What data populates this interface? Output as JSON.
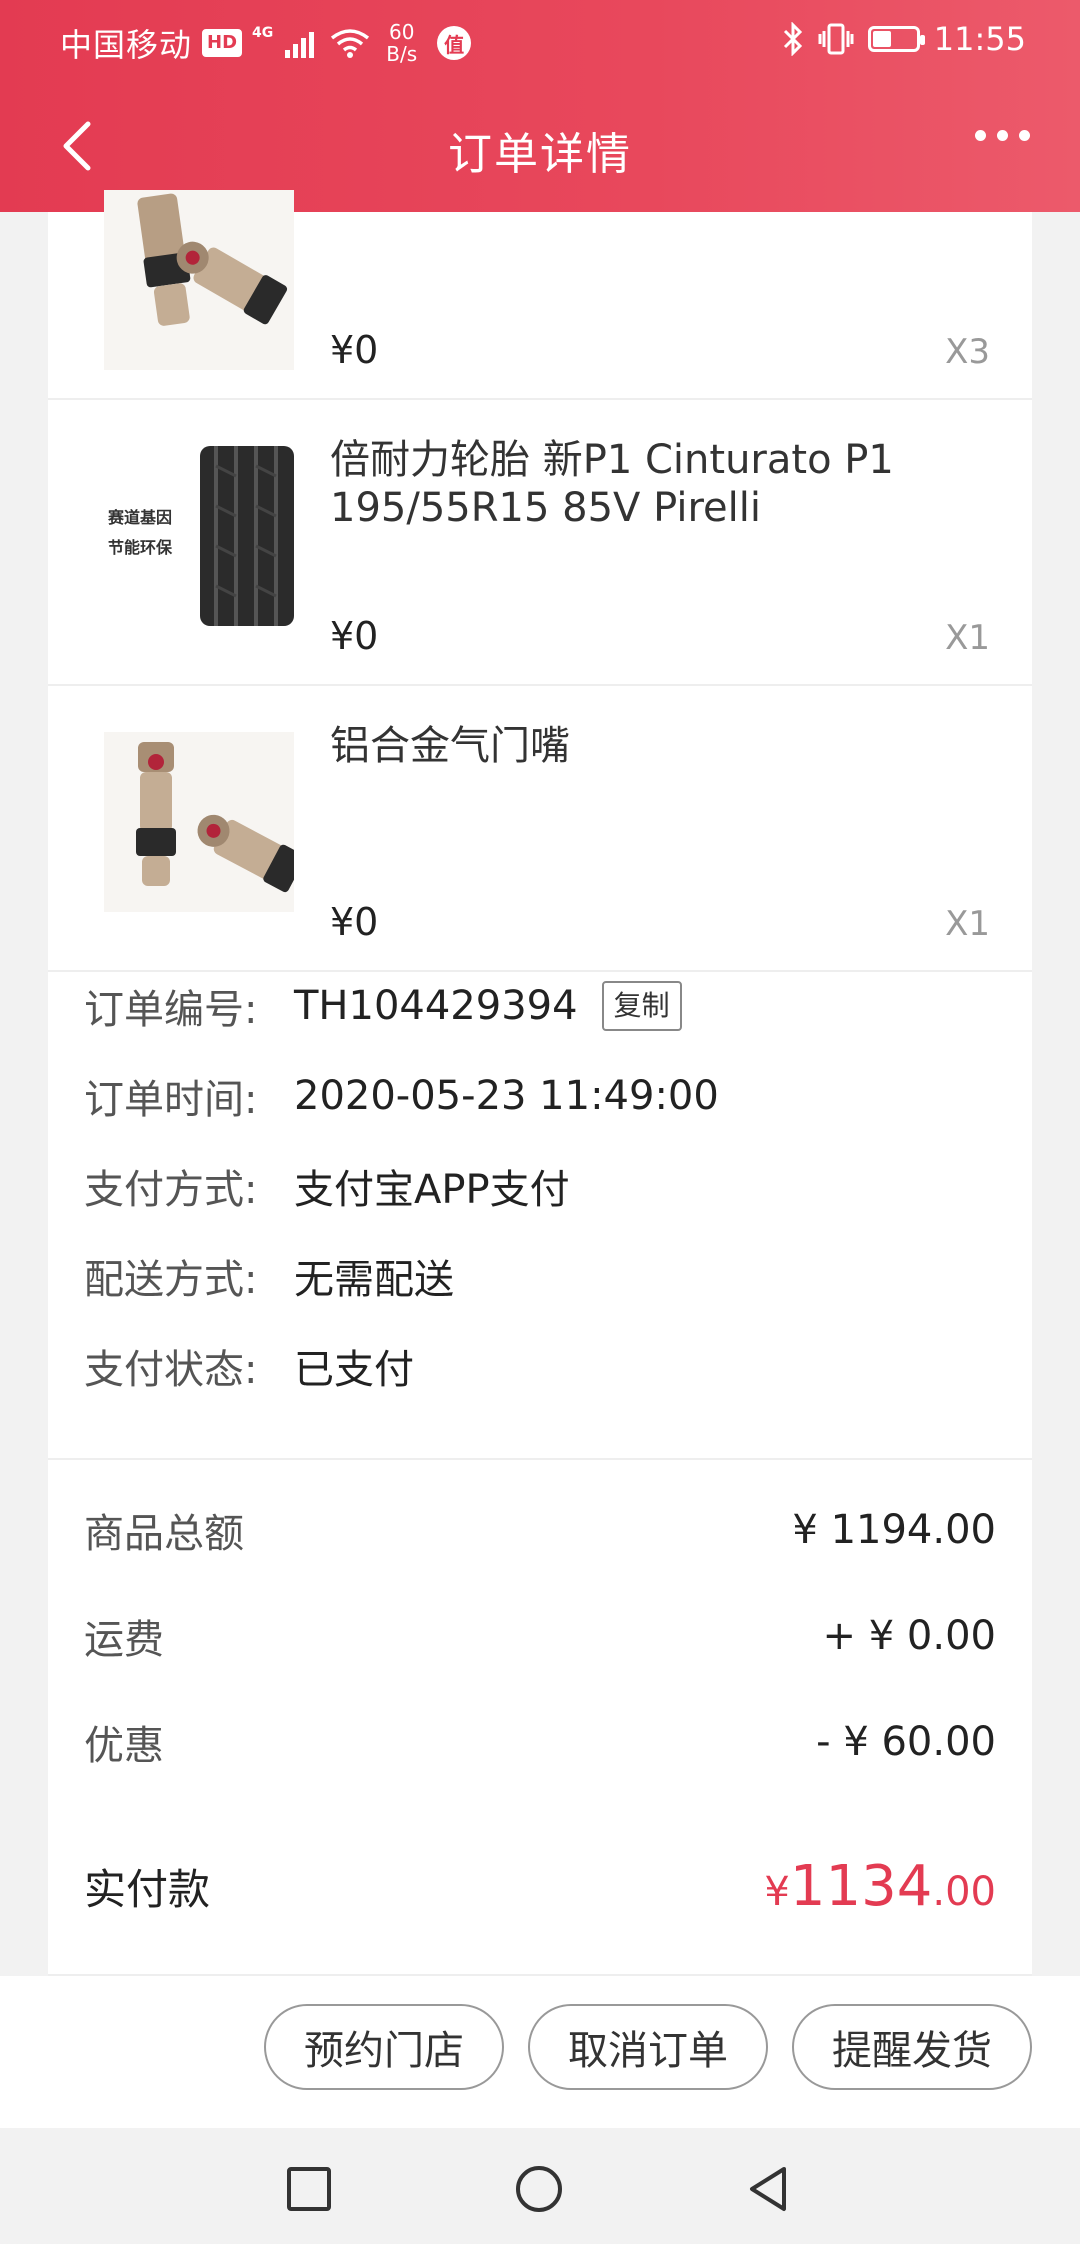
{
  "status_bar": {
    "carrier": "中国移动",
    "hd": "HD",
    "network": "4G",
    "speed_value": "60",
    "speed_unit": "B/s",
    "badge": "值",
    "time": "11:55",
    "battery_level": 0.4
  },
  "nav": {
    "title": "订单详情"
  },
  "products": [
    {
      "name": "",
      "price": "¥0",
      "qty": "X3",
      "image": "valve-image"
    },
    {
      "name": "倍耐力轮胎 新P1 Cinturato P1 195/55R15 85V Pirelli",
      "price": "¥0",
      "qty": "X1",
      "image": "tire-image",
      "image_tags": [
        "赛道基因",
        "节能环保"
      ]
    },
    {
      "name": "铝合金气门嘴",
      "price": "¥0",
      "qty": "X1",
      "image": "valve-image"
    }
  ],
  "order_info": {
    "number_label": "订单编号:",
    "number": "TH104429394",
    "copy_label": "复制",
    "time_label": "订单时间:",
    "time": "2020-05-23 11:49:00",
    "payment_label": "支付方式:",
    "payment": "支付宝APP支付",
    "delivery_label": "配送方式:",
    "delivery": "无需配送",
    "status_label": "支付状态:",
    "status": "已支付"
  },
  "summary": {
    "goods_total_label": "商品总额",
    "goods_total": "¥ 1194.00",
    "shipping_label": "运费",
    "shipping": "+ ¥ 0.00",
    "discount_label": "优惠",
    "discount": "- ¥ 60.00",
    "paid_label": "实付款",
    "paid_currency": "¥",
    "paid_int": "1134",
    "paid_dec": ".00"
  },
  "actions": {
    "reserve": "预约门店",
    "cancel": "取消订单",
    "remind": "提醒发货"
  },
  "colors": {
    "header": "#e8485c",
    "accent": "#e33b52"
  }
}
